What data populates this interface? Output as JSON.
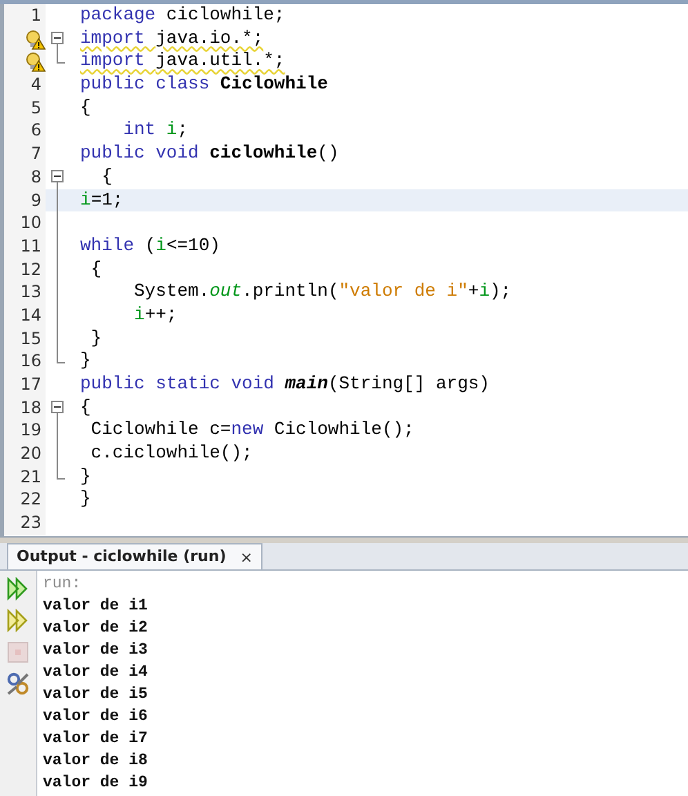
{
  "editor": {
    "lines": [
      {
        "number": "1",
        "fold_start": false,
        "fold_body": false,
        "fold_end": false,
        "warning": false,
        "current": false,
        "tokens": [
          {
            "kind": "keyword",
            "text": "package "
          },
          {
            "kind": "text",
            "text": "ciclowhile;"
          }
        ]
      },
      {
        "fold_start": true,
        "fold_body": false,
        "fold_end": false,
        "warning": true,
        "current": false,
        "tokens": [
          {
            "kind": "keyword",
            "text": "import "
          },
          {
            "kind": "text",
            "text": "java.io.*;"
          }
        ]
      },
      {
        "fold_start": false,
        "fold_body": false,
        "fold_end": true,
        "warning": true,
        "current": false,
        "tokens": [
          {
            "kind": "keyword",
            "text": "import "
          },
          {
            "kind": "text",
            "text": "java.util.*;"
          }
        ]
      },
      {
        "number": "4",
        "fold_start": false,
        "fold_body": false,
        "fold_end": false,
        "warning": false,
        "current": false,
        "tokens": [
          {
            "kind": "keyword",
            "text": "public class "
          },
          {
            "kind": "declaration",
            "text": "Ciclowhile"
          }
        ]
      },
      {
        "number": "5",
        "fold_start": false,
        "fold_body": false,
        "fold_end": false,
        "warning": false,
        "current": false,
        "tokens": [
          {
            "kind": "text",
            "text": "{"
          }
        ]
      },
      {
        "number": "6",
        "fold_start": false,
        "fold_body": false,
        "fold_end": false,
        "warning": false,
        "current": false,
        "tokens": [
          {
            "kind": "keyword",
            "text": "    int "
          },
          {
            "kind": "field",
            "text": "i"
          },
          {
            "kind": "text",
            "text": ";"
          }
        ]
      },
      {
        "number": "7",
        "fold_start": false,
        "fold_body": false,
        "fold_end": false,
        "warning": false,
        "current": false,
        "tokens": [
          {
            "kind": "keyword",
            "text": "public void "
          },
          {
            "kind": "declaration",
            "text": "ciclowhile"
          },
          {
            "kind": "text",
            "text": "()"
          }
        ]
      },
      {
        "number": "8",
        "fold_start": true,
        "fold_body": false,
        "fold_end": false,
        "warning": false,
        "current": false,
        "tokens": [
          {
            "kind": "text",
            "text": "  {"
          }
        ]
      },
      {
        "number": "9",
        "fold_start": false,
        "fold_body": true,
        "fold_end": false,
        "warning": false,
        "current": true,
        "tokens": [
          {
            "kind": "field",
            "text": "i"
          },
          {
            "kind": "text",
            "text": "=1;"
          }
        ]
      },
      {
        "number": "10",
        "fold_start": false,
        "fold_body": true,
        "fold_end": false,
        "warning": false,
        "current": false
      },
      {
        "number": "11",
        "fold_start": false,
        "fold_body": true,
        "fold_end": false,
        "warning": false,
        "current": false,
        "tokens": [
          {
            "kind": "keyword",
            "text": "while"
          },
          {
            "kind": "text",
            "text": " ("
          },
          {
            "kind": "field",
            "text": "i"
          },
          {
            "kind": "text",
            "text": "<=10)"
          }
        ]
      },
      {
        "number": "12",
        "fold_start": false,
        "fold_body": true,
        "fold_end": false,
        "warning": false,
        "current": false,
        "tokens": [
          {
            "kind": "text",
            "text": " {"
          }
        ]
      },
      {
        "number": "13",
        "fold_start": false,
        "fold_body": true,
        "fold_end": false,
        "warning": false,
        "current": false,
        "tokens": [
          {
            "kind": "text",
            "text": "     System."
          },
          {
            "kind": "static-field",
            "text": "out"
          },
          {
            "kind": "text",
            "text": ".println("
          },
          {
            "kind": "string",
            "text": "\"valor de i\""
          },
          {
            "kind": "text",
            "text": "+"
          },
          {
            "kind": "field",
            "text": "i"
          },
          {
            "kind": "text",
            "text": ");"
          }
        ]
      },
      {
        "number": "14",
        "fold_start": false,
        "fold_body": true,
        "fold_end": false,
        "warning": false,
        "current": false,
        "tokens": [
          {
            "kind": "field",
            "text": "     i"
          },
          {
            "kind": "text",
            "text": "++;"
          }
        ]
      },
      {
        "number": "15",
        "fold_start": false,
        "fold_body": true,
        "fold_end": false,
        "warning": false,
        "current": false,
        "tokens": [
          {
            "kind": "text",
            "text": " }"
          }
        ]
      },
      {
        "number": "16",
        "fold_start": false,
        "fold_body": false,
        "fold_end": true,
        "warning": false,
        "current": false,
        "tokens": [
          {
            "kind": "text",
            "text": "}"
          }
        ]
      },
      {
        "number": "17",
        "fold_start": false,
        "fold_body": false,
        "fold_end": false,
        "warning": false,
        "current": false,
        "tokens": [
          {
            "kind": "keyword",
            "text": "public static void "
          },
          {
            "kind": "static-declaration",
            "text": "main"
          },
          {
            "kind": "text",
            "text": "(String[] args)"
          }
        ]
      },
      {
        "number": "18",
        "fold_start": true,
        "fold_body": false,
        "fold_end": false,
        "warning": false,
        "current": false,
        "tokens": [
          {
            "kind": "text",
            "text": "{"
          }
        ]
      },
      {
        "number": "19",
        "fold_start": false,
        "fold_body": true,
        "fold_end": false,
        "warning": false,
        "current": false,
        "tokens": [
          {
            "kind": "text",
            "text": " Ciclowhile c="
          },
          {
            "kind": "keyword",
            "text": "new"
          },
          {
            "kind": "text",
            "text": " Ciclowhile();"
          }
        ]
      },
      {
        "number": "20",
        "fold_start": false,
        "fold_body": true,
        "fold_end": false,
        "warning": false,
        "current": false,
        "tokens": [
          {
            "kind": "text",
            "text": " c.ciclowhile();"
          }
        ]
      },
      {
        "number": "21",
        "fold_start": false,
        "fold_body": false,
        "fold_end": true,
        "warning": false,
        "current": false,
        "tokens": [
          {
            "kind": "text",
            "text": "}"
          }
        ]
      },
      {
        "number": "22",
        "fold_start": false,
        "fold_body": false,
        "fold_end": false,
        "warning": false,
        "current": false,
        "tokens": [
          {
            "kind": "text",
            "text": "}"
          }
        ]
      },
      {
        "number": "23",
        "fold_start": false,
        "fold_body": false,
        "fold_end": false,
        "warning": false,
        "current": false
      }
    ]
  },
  "output": {
    "tab": {
      "title": "Output - ciclowhile (run)",
      "close": "×"
    },
    "toolbar": [
      {
        "kind": "rerun",
        "disabled": false
      },
      {
        "kind": "rerun-options",
        "disabled": false
      },
      {
        "kind": "stop",
        "disabled": true
      },
      {
        "kind": "settings",
        "disabled": false
      }
    ],
    "lines": [
      {
        "kind": "system",
        "text": "run:"
      },
      {
        "kind": "stdout",
        "text": "valor de i1"
      },
      {
        "kind": "stdout",
        "text": "valor de i2"
      },
      {
        "kind": "stdout",
        "text": "valor de i3"
      },
      {
        "kind": "stdout",
        "text": "valor de i4"
      },
      {
        "kind": "stdout",
        "text": "valor de i5"
      },
      {
        "kind": "stdout",
        "text": "valor de i6"
      },
      {
        "kind": "stdout",
        "text": "valor de i7"
      },
      {
        "kind": "stdout",
        "text": "valor de i8"
      },
      {
        "kind": "stdout",
        "text": "valor de i9"
      }
    ]
  }
}
